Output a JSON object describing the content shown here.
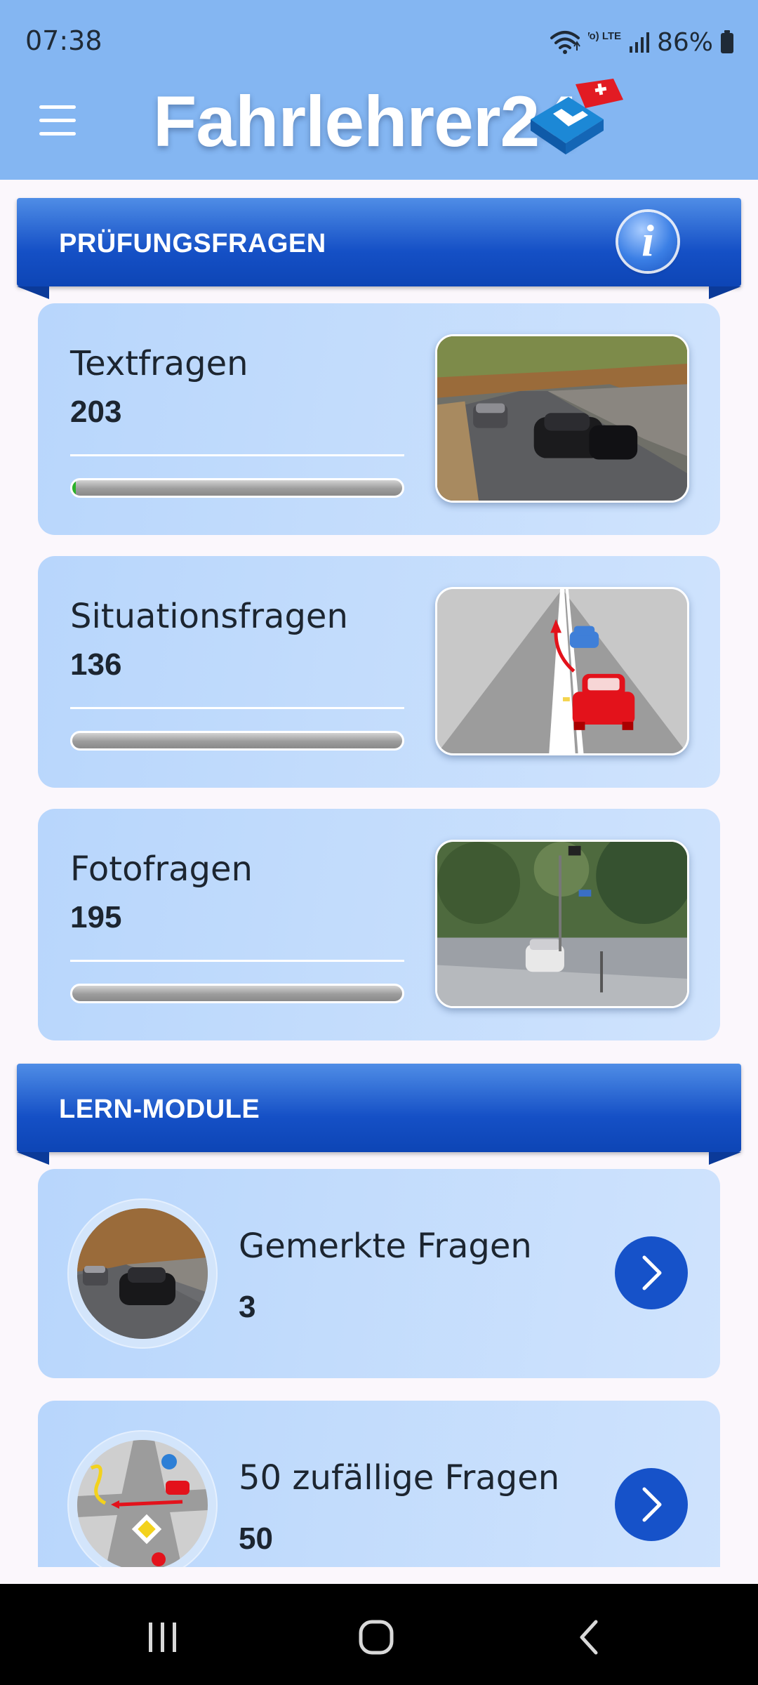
{
  "status_bar": {
    "time": "07:38",
    "network_label": "Vo) LTE1",
    "battery": "86%",
    "icons": [
      "wifi-icon",
      "volte-icon",
      "signal-icon",
      "battery-icon"
    ]
  },
  "app_bar": {
    "title": "Fahrlehrer24",
    "icons": [
      "menu-icon",
      "fahrlehrer24-logo"
    ]
  },
  "sections": {
    "exam_questions": {
      "title": "PRÜFUNGSFRAGEN",
      "info_icon": "info-icon",
      "cards": [
        {
          "label": "Textfragen",
          "count": "203",
          "progress": 0.01
        },
        {
          "label": "Situationsfragen",
          "count": "136",
          "progress": 0
        },
        {
          "label": "Fotofragen",
          "count": "195",
          "progress": 0
        }
      ]
    },
    "learn_modules": {
      "title": "LERN-MODULE",
      "cards": [
        {
          "label": "Gemerkte Fragen",
          "count": "3",
          "icon": "chevron-right-icon"
        },
        {
          "label": "50 zufällige Fragen",
          "count": "50",
          "icon": "chevron-right-icon"
        }
      ]
    }
  },
  "colors": {
    "app_bar": "#84b6f2",
    "banner": "#1550c6",
    "card": "#c3dcfc",
    "progress_fill": "#2ab22a",
    "action_button": "#1652c9"
  },
  "nav_bar": {
    "icons": [
      "recents-icon",
      "home-icon",
      "back-icon"
    ]
  }
}
